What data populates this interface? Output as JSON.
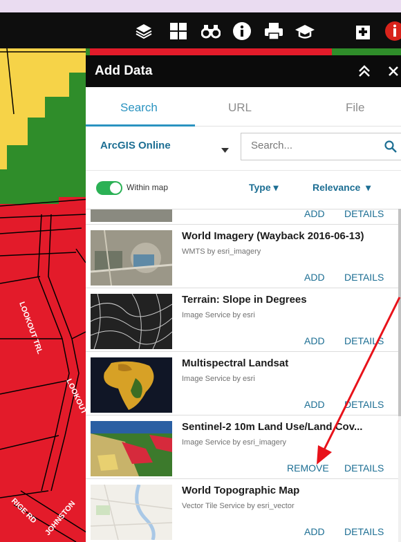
{
  "toolbar": {
    "icons": [
      "layers-icon",
      "basemap-gallery-icon",
      "binoculars-icon",
      "info-icon",
      "print-icon",
      "graduation-cap-icon",
      "add-data-icon",
      "alert-icon"
    ],
    "accent": "#d8231b"
  },
  "map": {
    "labels": [
      "LOOKOUT TRL",
      "LOOKOUT",
      "RIGE RD",
      "JOHNSTON"
    ]
  },
  "panel": {
    "title": "Add Data",
    "tabs": [
      {
        "label": "Search"
      },
      {
        "label": "URL"
      },
      {
        "label": "File"
      }
    ],
    "source": "ArcGIS Online",
    "search_placeholder": "Search...",
    "within_map_label": "Within map",
    "within_map_on": true,
    "type_filter": "Type",
    "relevance_filter": "Relevance",
    "partial_item": {
      "add_label": "ADD",
      "details_label": "DETAILS"
    },
    "items": [
      {
        "title": "World Imagery (Wayback 2016-06-13)",
        "subtitle": "WMTS by esri_imagery",
        "action": "ADD",
        "details": "DETAILS"
      },
      {
        "title": "Terrain: Slope in Degrees",
        "subtitle": "Image Service by esri",
        "action": "ADD",
        "details": "DETAILS"
      },
      {
        "title": "Multispectral Landsat",
        "subtitle": "Image Service by esri",
        "action": "ADD",
        "details": "DETAILS"
      },
      {
        "title": "Sentinel-2 10m Land Use/Land Cov...",
        "subtitle": "Image Service by esri_imagery",
        "action": "REMOVE",
        "details": "DETAILS"
      },
      {
        "title": "World Topographic Map",
        "subtitle": "Vector Tile Service by esri_vector",
        "action": "ADD",
        "details": "DETAILS"
      }
    ]
  },
  "colors": {
    "accent_blue": "#1c6e93",
    "tab_active": "#2a93c0",
    "toggle_on": "#2bb155",
    "map_red": "#e31b2a",
    "map_yellow": "#f6d348",
    "map_green": "#2f8d2a",
    "annotation_arrow": "#e8121a"
  }
}
